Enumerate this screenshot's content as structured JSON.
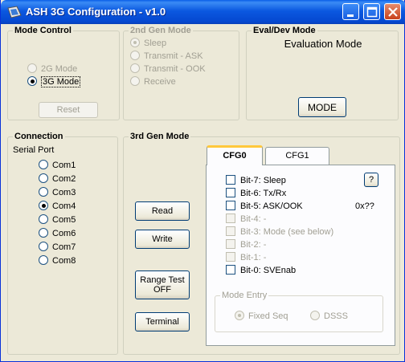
{
  "window": {
    "title": "ASH 3G Configuration - v1.0"
  },
  "mode_control": {
    "title": "Mode Control",
    "options": [
      "2G Mode",
      "3G Mode"
    ],
    "selected": "3G Mode",
    "reset_label": "Reset"
  },
  "gen2_mode": {
    "title": "2nd Gen Mode",
    "options": [
      "Sleep",
      "Transmit - ASK",
      "Transmit - OOK",
      "Receive"
    ],
    "selected": "Sleep"
  },
  "eval_dev": {
    "title": "Eval/Dev Mode",
    "status": "Evaluation Mode",
    "mode_button": "MODE"
  },
  "connection": {
    "title": "Connection",
    "subtitle": "Serial Port",
    "ports": [
      "Com1",
      "Com2",
      "Com3",
      "Com4",
      "Com5",
      "Com6",
      "Com7",
      "Com8"
    ],
    "selected": "Com4"
  },
  "gen3_mode": {
    "title": "3rd Gen Mode",
    "read_label": "Read",
    "write_label": "Write",
    "range_test_line1": "Range Test",
    "range_test_line2": "OFF",
    "terminal_label": "Terminal",
    "tabs": [
      "CFG0",
      "CFG1"
    ],
    "active_tab": "CFG0",
    "help_label": "?",
    "hex_value": "0x??",
    "bits": [
      {
        "label": "Bit-7:  Sleep",
        "enabled": true
      },
      {
        "label": "Bit-6:  Tx/Rx",
        "enabled": true
      },
      {
        "label": "Bit-5:  ASK/OOK",
        "enabled": true
      },
      {
        "label": "Bit-4:  -",
        "enabled": false
      },
      {
        "label": "Bit-3:  Mode (see below)",
        "enabled": false
      },
      {
        "label": "Bit-2:  -",
        "enabled": false
      },
      {
        "label": "Bit-1:  -",
        "enabled": false
      },
      {
        "label": "Bit-0:  SVEnab",
        "enabled": true
      }
    ],
    "mode_entry": {
      "title": "Mode Entry",
      "options": [
        "Fixed Seq",
        "DSSS"
      ],
      "selected": "Fixed Seq"
    }
  }
}
